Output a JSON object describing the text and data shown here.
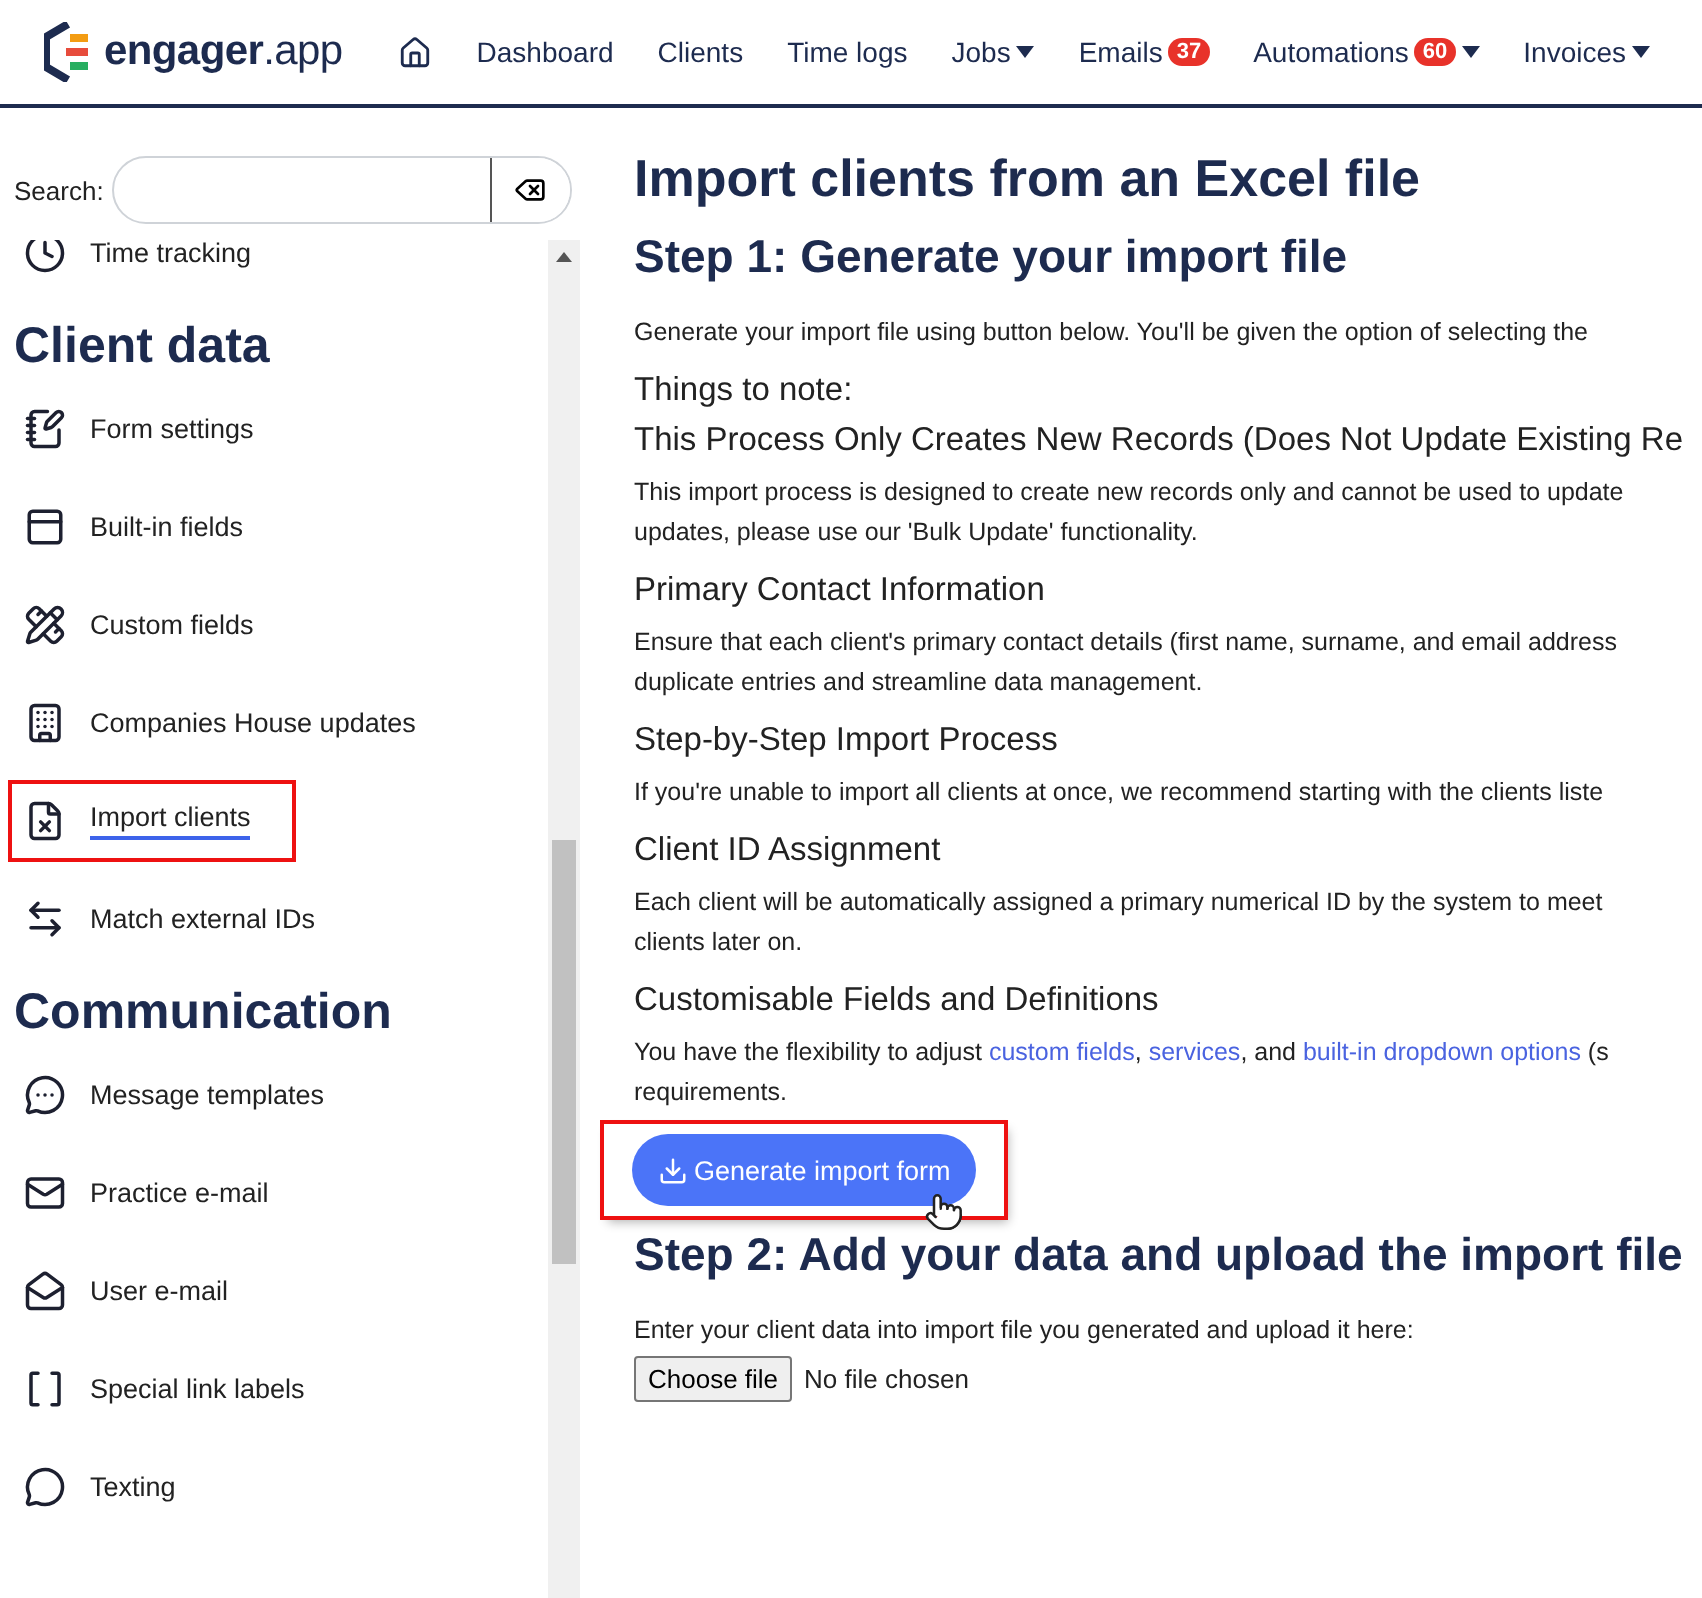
{
  "brand": {
    "name": "engager",
    "suffix": ".app"
  },
  "nav": [
    {
      "label": "Dashboard",
      "dropdown": false
    },
    {
      "label": "Clients",
      "dropdown": false
    },
    {
      "label": "Time logs",
      "dropdown": false
    },
    {
      "label": "Jobs",
      "dropdown": true
    },
    {
      "label": "Emails",
      "badge": "37",
      "dropdown": false
    },
    {
      "label": "Automations",
      "badge": "60",
      "dropdown": true
    },
    {
      "label": "Invoices",
      "dropdown": true
    }
  ],
  "sidebar": {
    "search_label": "Search:",
    "items": [
      {
        "kind": "item",
        "label": "Time tracking",
        "selected": false
      },
      {
        "kind": "heading",
        "label": "Client data"
      },
      {
        "kind": "item",
        "label": "Form settings",
        "selected": false
      },
      {
        "kind": "item",
        "label": "Built-in fields",
        "selected": false
      },
      {
        "kind": "item",
        "label": "Custom fields",
        "selected": false
      },
      {
        "kind": "item",
        "label": "Companies House updates",
        "selected": false
      },
      {
        "kind": "item",
        "label": "Import clients",
        "selected": true
      },
      {
        "kind": "item",
        "label": "Match external IDs",
        "selected": false
      },
      {
        "kind": "heading",
        "label": "Communication"
      },
      {
        "kind": "item",
        "label": "Message templates",
        "selected": false
      },
      {
        "kind": "item",
        "label": "Practice e-mail",
        "selected": false
      },
      {
        "kind": "item",
        "label": "User e-mail",
        "selected": false
      },
      {
        "kind": "item",
        "label": "Special link labels",
        "selected": false
      },
      {
        "kind": "item",
        "label": "Texting",
        "selected": false
      }
    ]
  },
  "main": {
    "title": "Import clients from an Excel file",
    "step1": {
      "title": "Step 1: Generate your import file",
      "intro": "Generate your import file using button below. You'll be given the option of selecting the"
    },
    "notes_title": "Things to note:",
    "notes": [
      {
        "title": "This Process Only Creates New Records (Does Not Update Existing Re",
        "lines": [
          [
            {
              "kind": "text",
              "text": "This import process is designed to create new records only and cannot be used to update"
            }
          ],
          [
            {
              "kind": "text",
              "text": "updates, please use our 'Bulk Update' functionality."
            }
          ]
        ]
      },
      {
        "title": "Primary Contact Information",
        "lines": [
          [
            {
              "kind": "text",
              "text": "Ensure that each client's primary contact details (first name, surname, and email address"
            }
          ],
          [
            {
              "kind": "text",
              "text": "duplicate entries and streamline data management."
            }
          ]
        ]
      },
      {
        "title": "Step-by-Step Import Process",
        "lines": [
          [
            {
              "kind": "text",
              "text": "If you're unable to import all clients at once, we recommend starting with the clients liste"
            }
          ]
        ]
      },
      {
        "title": "Client ID Assignment",
        "lines": [
          [
            {
              "kind": "text",
              "text": "Each client will be automatically assigned a primary numerical ID by the system to meet"
            }
          ],
          [
            {
              "kind": "text",
              "text": "clients later on."
            }
          ]
        ]
      },
      {
        "title": "Customisable Fields and Definitions",
        "lines": [
          [
            {
              "kind": "text",
              "text": "You have the flexibility to adjust "
            },
            {
              "kind": "link",
              "text": "custom fields"
            },
            {
              "kind": "text",
              "text": ", "
            },
            {
              "kind": "link",
              "text": "services"
            },
            {
              "kind": "text",
              "text": ", and "
            },
            {
              "kind": "link",
              "text": "built-in dropdown options"
            },
            {
              "kind": "text",
              "text": " (s"
            }
          ],
          [
            {
              "kind": "text",
              "text": "requirements."
            }
          ]
        ]
      }
    ],
    "generate_button": {
      "label": "Generate import form",
      "highlighted": true
    },
    "step2": {
      "title": "Step 2: Add your data and upload the import file",
      "intro": "Enter your client data into import file you generated and upload it here:",
      "choose_label": "Choose file",
      "file_status": "No file chosen"
    }
  }
}
